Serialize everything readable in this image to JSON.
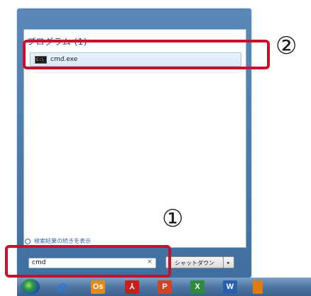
{
  "start_menu": {
    "programs_header": "プログラム (1)",
    "results": [
      {
        "label": "cmd.exe",
        "icon": "cmd-icon"
      }
    ],
    "more_results_label": "検索結果の続きを表示",
    "search": {
      "value": "cmd",
      "clear_glyph": "×"
    },
    "shutdown_label": "シャットダウン",
    "shutdown_arrow": "▸"
  },
  "taskbar": {
    "icons": [
      "start-orb",
      "internet-explorer-icon",
      "outlook-icon",
      "acrobat-icon",
      "powerpoint-icon",
      "excel-icon",
      "word-icon",
      "app-icon"
    ],
    "labels": {
      "ie": "e",
      "outlook": "Os",
      "acrobat": "⅄",
      "ppt": "P",
      "excel": "X",
      "word": "W",
      "extra": ""
    }
  },
  "annotations": {
    "step1": "①",
    "step2": "②",
    "color": "#c8102e"
  }
}
